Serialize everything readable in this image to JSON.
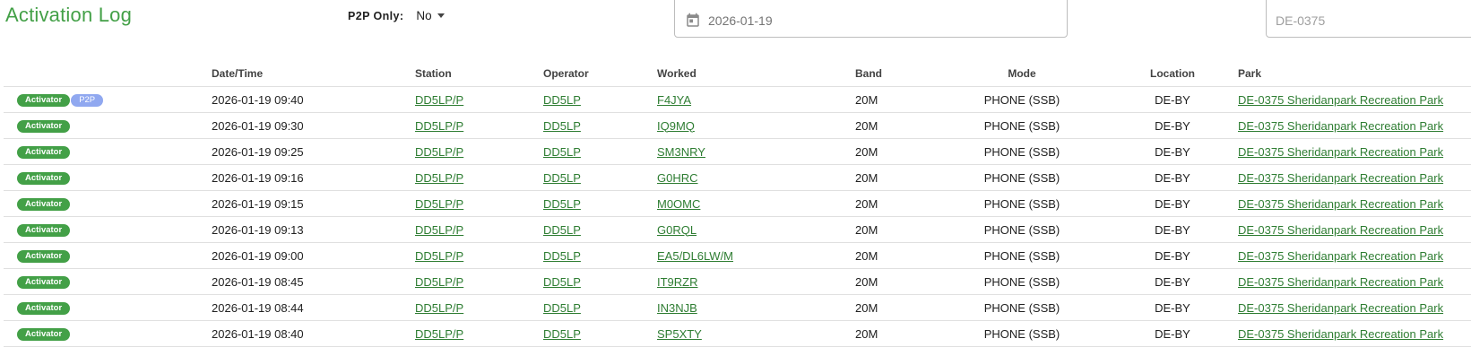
{
  "page": {
    "title": "Activation Log"
  },
  "filters": {
    "p2p_label": "P2P Only:",
    "p2p_value": "No",
    "date_value": "2026-01-19",
    "park_value": "DE-0375"
  },
  "colors": {
    "accent": "#43a047",
    "link": "#2e7d32",
    "badge_activator": "#43a047",
    "badge_p2p": "#90a8f0"
  },
  "table": {
    "headers": [
      "",
      "Date/Time",
      "Station",
      "Operator",
      "Worked",
      "Band",
      "Mode",
      "Location",
      "Park"
    ],
    "rows": [
      {
        "role": "Activator",
        "p2p": "P2P",
        "datetime": "2026-01-19 09:40",
        "station": "DD5LP/P",
        "operator": "DD5LP",
        "worked": "F4JYA",
        "band": "20M",
        "mode": "PHONE (SSB)",
        "location": "DE-BY",
        "park": "DE-0375 Sheridanpark Recreation Park"
      },
      {
        "role": "Activator",
        "p2p": "",
        "datetime": "2026-01-19 09:30",
        "station": "DD5LP/P",
        "operator": "DD5LP",
        "worked": "IQ9MQ",
        "band": "20M",
        "mode": "PHONE (SSB)",
        "location": "DE-BY",
        "park": "DE-0375 Sheridanpark Recreation Park"
      },
      {
        "role": "Activator",
        "p2p": "",
        "datetime": "2026-01-19 09:25",
        "station": "DD5LP/P",
        "operator": "DD5LP",
        "worked": "SM3NRY",
        "band": "20M",
        "mode": "PHONE (SSB)",
        "location": "DE-BY",
        "park": "DE-0375 Sheridanpark Recreation Park"
      },
      {
        "role": "Activator",
        "p2p": "",
        "datetime": "2026-01-19 09:16",
        "station": "DD5LP/P",
        "operator": "DD5LP",
        "worked": "G0HRC",
        "band": "20M",
        "mode": "PHONE (SSB)",
        "location": "DE-BY",
        "park": "DE-0375 Sheridanpark Recreation Park"
      },
      {
        "role": "Activator",
        "p2p": "",
        "datetime": "2026-01-19 09:15",
        "station": "DD5LP/P",
        "operator": "DD5LP",
        "worked": "M0OMC",
        "band": "20M",
        "mode": "PHONE (SSB)",
        "location": "DE-BY",
        "park": "DE-0375 Sheridanpark Recreation Park"
      },
      {
        "role": "Activator",
        "p2p": "",
        "datetime": "2026-01-19 09:13",
        "station": "DD5LP/P",
        "operator": "DD5LP",
        "worked": "G0RQL",
        "band": "20M",
        "mode": "PHONE (SSB)",
        "location": "DE-BY",
        "park": "DE-0375 Sheridanpark Recreation Park"
      },
      {
        "role": "Activator",
        "p2p": "",
        "datetime": "2026-01-19 09:00",
        "station": "DD5LP/P",
        "operator": "DD5LP",
        "worked": "EA5/DL6LW/M",
        "band": "20M",
        "mode": "PHONE (SSB)",
        "location": "DE-BY",
        "park": "DE-0375 Sheridanpark Recreation Park"
      },
      {
        "role": "Activator",
        "p2p": "",
        "datetime": "2026-01-19 08:45",
        "station": "DD5LP/P",
        "operator": "DD5LP",
        "worked": "IT9RZR",
        "band": "20M",
        "mode": "PHONE (SSB)",
        "location": "DE-BY",
        "park": "DE-0375 Sheridanpark Recreation Park"
      },
      {
        "role": "Activator",
        "p2p": "",
        "datetime": "2026-01-19 08:44",
        "station": "DD5LP/P",
        "operator": "DD5LP",
        "worked": "IN3NJB",
        "band": "20M",
        "mode": "PHONE (SSB)",
        "location": "DE-BY",
        "park": "DE-0375 Sheridanpark Recreation Park"
      },
      {
        "role": "Activator",
        "p2p": "",
        "datetime": "2026-01-19 08:40",
        "station": "DD5LP/P",
        "operator": "DD5LP",
        "worked": "SP5XTY",
        "band": "20M",
        "mode": "PHONE (SSB)",
        "location": "DE-BY",
        "park": "DE-0375 Sheridanpark Recreation Park"
      }
    ]
  }
}
